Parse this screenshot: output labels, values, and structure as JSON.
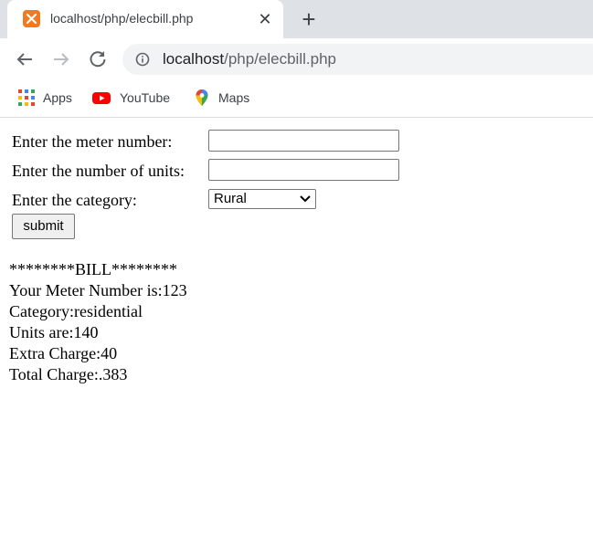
{
  "browser": {
    "tab": {
      "title": "localhost/php/elecbill.php",
      "close": "✕"
    },
    "newtab": "+",
    "url": {
      "host": "localhost",
      "path": "/php/elecbill.php"
    },
    "bookmarks": [
      {
        "label": "Apps",
        "icon": "apps-grid-icon"
      },
      {
        "label": "YouTube",
        "icon": "youtube-icon"
      },
      {
        "label": "Maps",
        "icon": "maps-pin-icon"
      }
    ]
  },
  "form": {
    "meter_label": "Enter the meter number:",
    "meter_value": "",
    "units_label": "Enter the number of units:",
    "units_value": "",
    "category_label": "Enter the category:",
    "category_value": "Rural",
    "submit_label": "submit"
  },
  "output": {
    "header": "********BILL********",
    "meter": "Your Meter Number is:123",
    "category": "Category:residential",
    "units": "Units are:140",
    "extra": "Extra Charge:40",
    "total": "Total Charge:.383"
  },
  "colors": {
    "tabstrip": "#dee1e6",
    "favicon": "#f07a22",
    "youtube": "#ff0000"
  }
}
